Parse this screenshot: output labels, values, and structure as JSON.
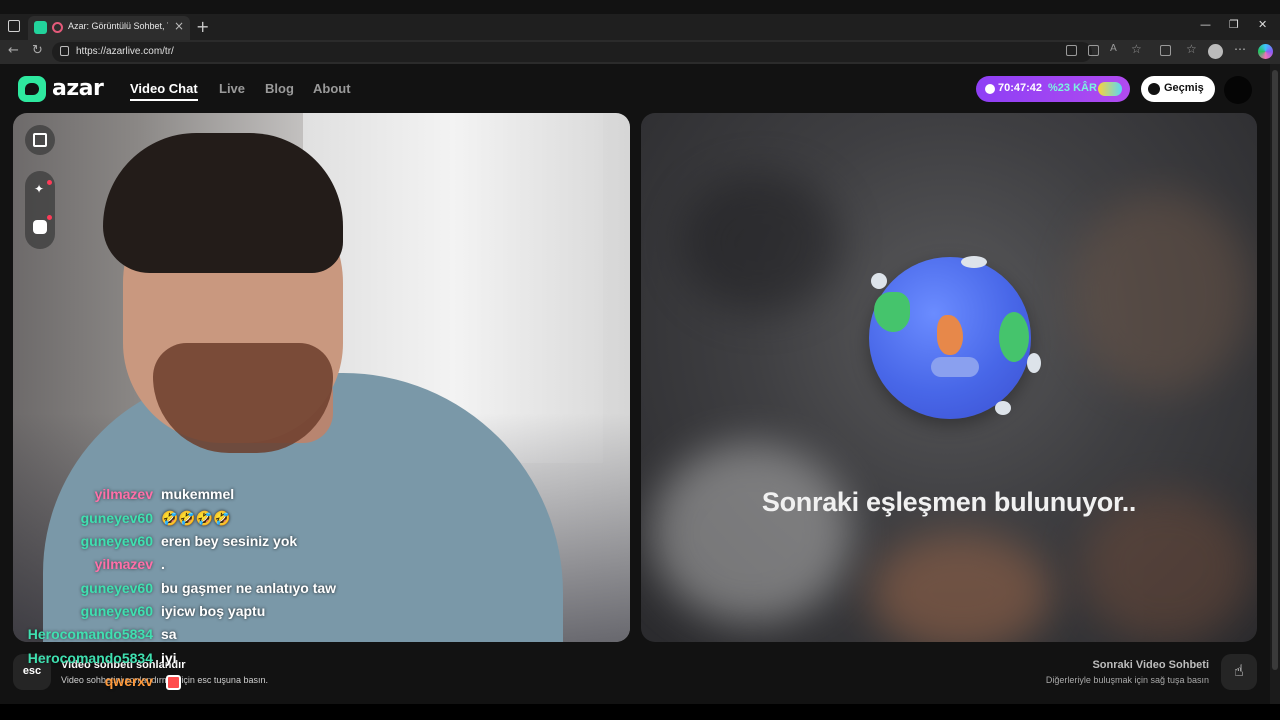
{
  "browser": {
    "tab_title": "Azar: Görüntülü Sohbet, Yen",
    "tab_close": "×",
    "new_tab": "+",
    "url": "https://azarlive.com/tr/",
    "minimize": "—",
    "restore": "❐",
    "close": "✕"
  },
  "header": {
    "logo_text": "azar",
    "nav": [
      {
        "label": "Video Chat",
        "active": true
      },
      {
        "label": "Live",
        "active": false
      },
      {
        "label": "Blog",
        "active": false
      },
      {
        "label": "About",
        "active": false
      }
    ],
    "timer": "70:47:42",
    "profit": "%23 KÂR",
    "history_label": "Geçmiş"
  },
  "chat": [
    {
      "user": "yilmazev",
      "message": "mukemmel",
      "color": "#ff6fa8"
    },
    {
      "user": "guneyev60",
      "message": "🤣🤣🤣🤣",
      "color": "#3fe0b0"
    },
    {
      "user": "guneyev60",
      "message": "eren bey sesiniz yok",
      "color": "#3fe0b0"
    },
    {
      "user": "yilmazev",
      "message": ".",
      "color": "#ff6fa8"
    },
    {
      "user": "guneyev60",
      "message": "bu gaşmer ne anlatıyo taw",
      "color": "#3fe0b0"
    },
    {
      "user": "guneyev60",
      "message": "iyicw boş yaptu",
      "color": "#3fe0b0"
    },
    {
      "user": "Herocomando5834",
      "message": "sa",
      "color": "#3fe0b0"
    },
    {
      "user": "Herocomando5834",
      "message": "iyi",
      "color": "#3fe0b0"
    },
    {
      "user": "qwerxv",
      "message": "",
      "color": "#ff9a3c"
    }
  ],
  "matching": {
    "text": "Sonraki eşleşmen bulunuyor.."
  },
  "footer": {
    "esc_label": "esc",
    "end_title": "Video sohbeti sonlandır",
    "end_desc": "Video sohbetini sonlandırmak için esc tuşuna basın.",
    "next_title": "Sonraki Video Sohbeti",
    "next_desc": "Diğerleriyle buluşmak için sağ tuşa basın"
  },
  "colors": {
    "accent_green": "#2ee89f",
    "timer_purple": "#9b44f3",
    "chat_user_green": "#3fe0b0",
    "chat_user_pink": "#ff6fa8",
    "chat_user_orange": "#ff9a3c"
  }
}
